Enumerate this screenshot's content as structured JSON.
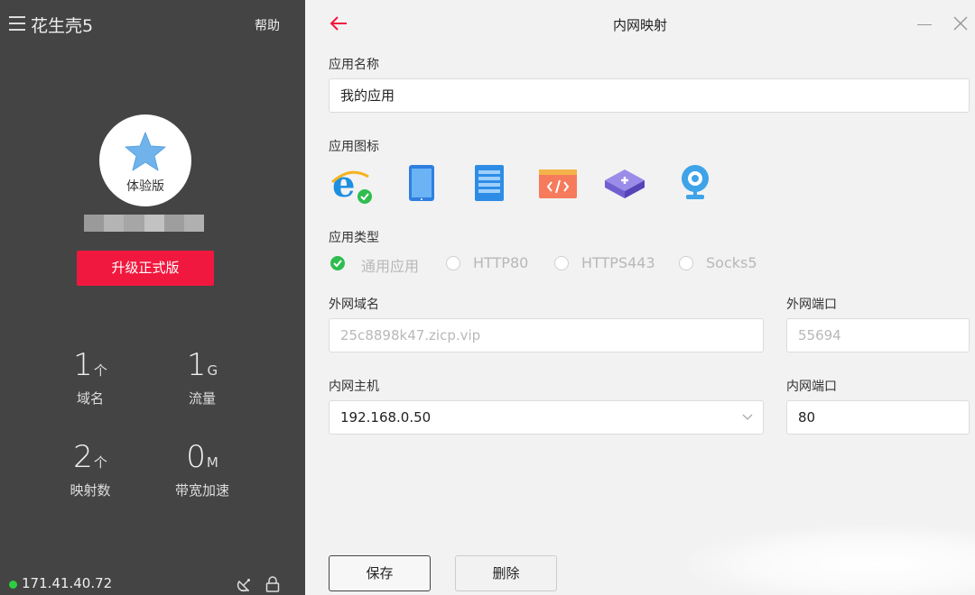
{
  "sidebar": {
    "app_title": "花生壳5",
    "help_label": "帮助",
    "avatar_label": "体验版",
    "upgrade_label": "升级正式版",
    "stats": [
      {
        "num": "1",
        "unit": "个",
        "label": "域名"
      },
      {
        "num": "1",
        "unit": "G",
        "label": "流量"
      },
      {
        "num": "2",
        "unit": "个",
        "label": "映射数"
      },
      {
        "num": "0",
        "unit": "M",
        "label": "带宽加速"
      }
    ],
    "ip": "171.41.40.72",
    "status_color": "#2ecc40"
  },
  "dialog": {
    "title": "内网映射",
    "app_name_label": "应用名称",
    "app_name_value": "我的应用",
    "app_icon_label": "应用图标",
    "icons": [
      "ie-icon",
      "tablet-icon",
      "server-icon",
      "code-window-icon",
      "router-icon",
      "webcam-icon"
    ],
    "app_type_label": "应用类型",
    "app_types": [
      "通用应用",
      "HTTP80",
      "HTTPS443",
      "Socks5"
    ],
    "selected_type": "通用应用",
    "ext_domain_label": "外网域名",
    "ext_domain_value": "25c8898k47.zicp.vip",
    "ext_port_label": "外网端口",
    "ext_port_value": "55694",
    "int_host_label": "内网主机",
    "int_host_value": "192.168.0.50",
    "int_port_label": "内网端口",
    "int_port_value": "80",
    "save_label": "保存",
    "delete_label": "删除",
    "accent_color": "#f0183f"
  }
}
